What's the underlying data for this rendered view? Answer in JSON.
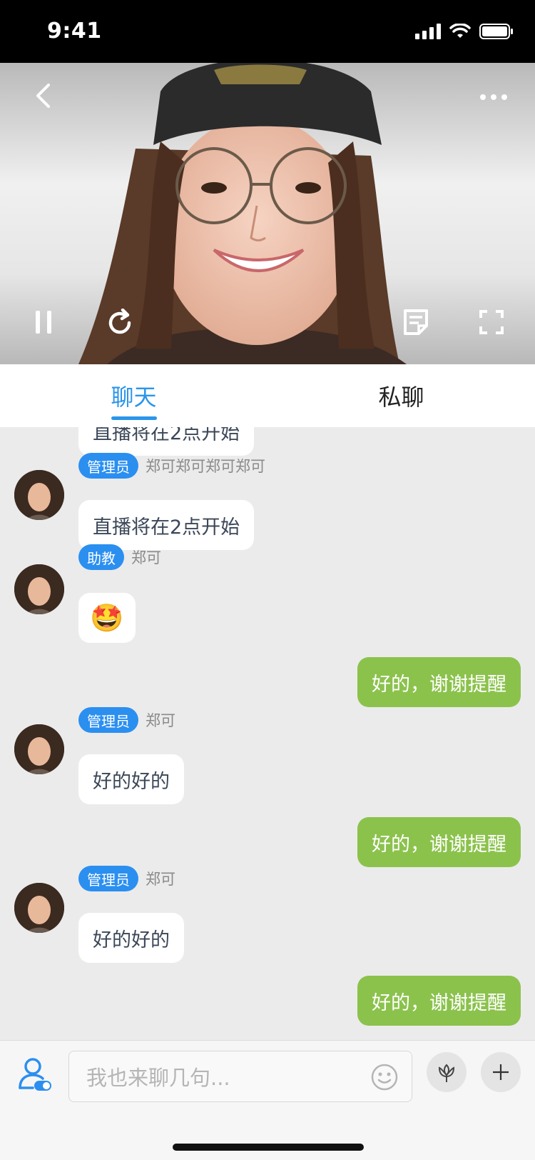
{
  "status_bar": {
    "time": "9:41"
  },
  "tabs": [
    {
      "label": "聊天",
      "active": true
    },
    {
      "label": "私聊",
      "active": false
    }
  ],
  "messages": [
    {
      "side": "other",
      "text": "直播将在2点开始"
    },
    {
      "side": "other",
      "badge": "管理员",
      "sender": "郑可郑可郑可郑可",
      "text": "直播将在2点开始"
    },
    {
      "side": "other",
      "badge": "助教",
      "sender": "郑可",
      "emoji": "🤩"
    },
    {
      "side": "me",
      "text": "好的，谢谢提醒"
    },
    {
      "side": "other",
      "badge": "管理员",
      "sender": "郑可",
      "text": "好的好的"
    },
    {
      "side": "me",
      "text": "好的，谢谢提醒"
    },
    {
      "side": "other",
      "badge": "管理员",
      "sender": "郑可",
      "text": "好的好的"
    },
    {
      "side": "me",
      "text": "好的，谢谢提醒"
    }
  ],
  "input": {
    "placeholder": "我也来聊几句..."
  },
  "colors": {
    "accent": "#2b95e9",
    "my_bubble": "#8bc24c",
    "badge": "#2b8ff0"
  },
  "icons": [
    "back-icon",
    "more-icon",
    "pause-icon",
    "refresh-icon",
    "notes-icon",
    "fullscreen-icon",
    "user-toggle-icon",
    "emoji-icon",
    "flower-icon",
    "plus-icon"
  ]
}
